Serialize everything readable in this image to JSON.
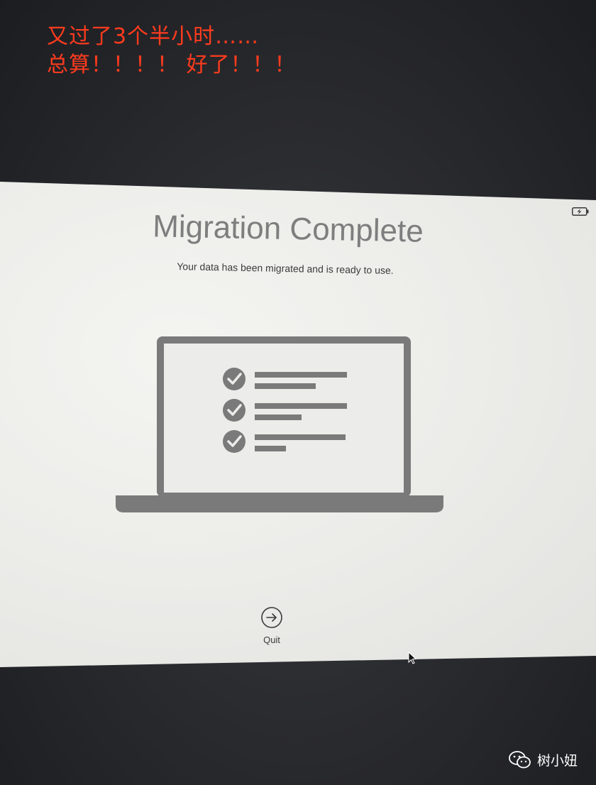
{
  "annotation": {
    "line1": "又过了3个半小时……",
    "line2": "总算！！！！ 好了！！！",
    "color": "#ff3b1e"
  },
  "screen": {
    "title": "Migration Complete",
    "subtitle": "Your data has been migrated and is ready to use.",
    "status_icon": "battery-charging-icon",
    "illustration": {
      "icon": "laptop-checklist-icon",
      "checklist_items": 3
    },
    "quit_button": {
      "label": "Quit",
      "icon": "arrow-right-circle-icon"
    }
  },
  "watermark": {
    "icon": "wechat-icon",
    "text": "树小妞"
  },
  "colors": {
    "screen_background": "#ececea",
    "illustration_gray": "#7a7a7a",
    "title_gray": "#7e7e7e"
  }
}
